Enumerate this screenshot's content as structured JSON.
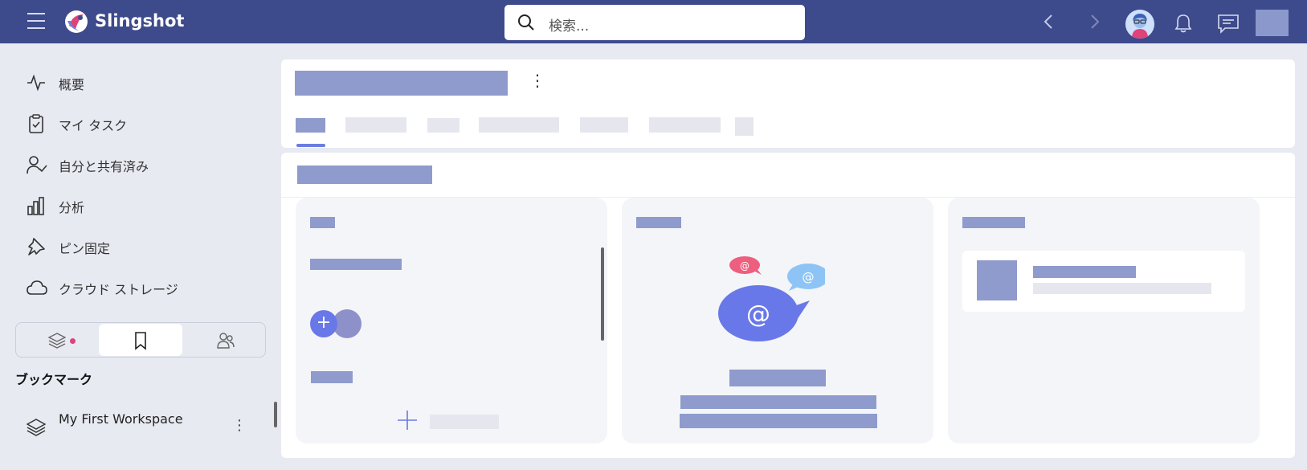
{
  "app": {
    "brand": "Slingshot",
    "search_placeholder": "検索..."
  },
  "sidebar": {
    "items": [
      {
        "label": "概要",
        "icon": "activity-icon"
      },
      {
        "label": "マイ タスク",
        "icon": "clipboard-check-icon"
      },
      {
        "label": "自分と共有済み",
        "icon": "user-check-icon"
      },
      {
        "label": "分析",
        "icon": "bar-chart-icon"
      },
      {
        "label": "ピン固定",
        "icon": "pin-icon"
      },
      {
        "label": "クラウド ストレージ",
        "icon": "cloud-icon"
      }
    ],
    "segment": {
      "tabs": [
        "layers-icon",
        "bookmark-icon",
        "people-icon"
      ],
      "active_index": 1
    },
    "bookmarks_heading": "ブックマーク",
    "workspace": {
      "name": "My First Workspace",
      "icon": "layers-icon"
    }
  },
  "colors": {
    "topbar": "#3d4a8c",
    "placeholder": "#8f9bcc",
    "accent": "#6978e8",
    "badge": "#e0427a"
  }
}
